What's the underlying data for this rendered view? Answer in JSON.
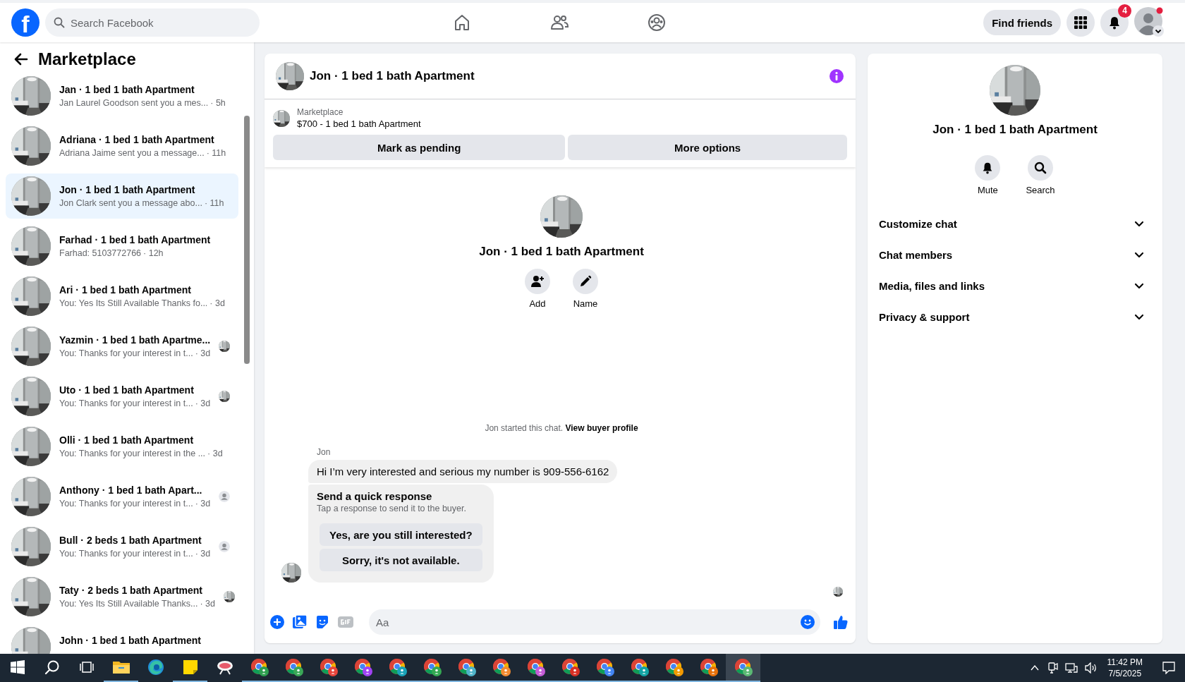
{
  "top_bar": {
    "logo": "f",
    "search": {
      "placeholder": "Search Facebook"
    },
    "nav": [
      {
        "kind": "home",
        "selected": false
      },
      {
        "kind": "friends",
        "selected": false
      },
      {
        "kind": "groups",
        "selected": false
      }
    ],
    "find_friends": "Find friends",
    "notifications_badge": "4"
  },
  "sidebar": {
    "title": "Marketplace",
    "conversations": [
      {
        "title": "Jan · 1 bed 1 bath Apartment",
        "preview": "Jan Laurel Goodson sent you a mes...",
        "time": "· 5h",
        "selected": false
      },
      {
        "title": "Adriana · 1 bed 1 bath Apartment",
        "preview": "Adriana Jaime sent you a message...",
        "time": "· 11h",
        "selected": false
      },
      {
        "title": "Jon · 1 bed 1 bath Apartment",
        "preview": "Jon Clark sent you a message abo...",
        "time": "· 11h",
        "selected": true
      },
      {
        "title": "Farhad · 1 bed 1 bath Apartment",
        "preview": "Farhad: 5103772766",
        "time": "· 12h",
        "selected": false
      },
      {
        "title": "Ari · 1 bed 1 bath Apartment",
        "preview": "You: Yes Its Still Available Thanks fo...",
        "time": "· 3d",
        "selected": false
      },
      {
        "title": "Yazmin · 1 bed 1 bath Apartme...",
        "preview": "You: Thanks for your interest in t...",
        "time": "· 3d",
        "selected": false
      },
      {
        "title": "Uto · 1 bed 1 bath Apartment",
        "preview": "You: Thanks for your interest in t...",
        "time": "· 3d",
        "selected": false
      },
      {
        "title": "Olli · 1 bed 1 bath Apartment",
        "preview": "You: Thanks for your interest in the ...",
        "time": "· 3d",
        "selected": false
      },
      {
        "title": "Anthony · 1 bed 1 bath Apart...",
        "preview": "You: Thanks for your interest in t...",
        "time": "· 3d",
        "selected": false,
        "receipt": {
          "kind": "silhouette"
        }
      },
      {
        "title": "Bull · 2 beds 1 bath Apartment",
        "preview": "You: Thanks for your interest in t...",
        "time": "· 3d",
        "selected": false,
        "receipt": {
          "kind": "silhouette"
        }
      },
      {
        "title": "Taty · 2 beds 1 bath Apartment",
        "preview": "You: Yes Its Still Available Thanks...",
        "time": "· 3d",
        "selected": false
      },
      {
        "title": "John · 1 bed 1 bath Apartment",
        "selected": false
      }
    ]
  },
  "chat": {
    "title": "Jon · 1 bed 1 bath Apartment",
    "listing": {
      "label": "Marketplace",
      "name": "$700 - 1 bed 1 bath Apartment"
    },
    "actions": [
      "Mark as pending",
      "More options"
    ],
    "profile": {
      "title": "Jon · 1 bed 1 bath Apartment",
      "actions": [
        {
          "kind": "add",
          "label": "Add"
        },
        {
          "kind": "name",
          "label": "Name"
        }
      ]
    },
    "notice": {
      "text": "Jon started this chat.",
      "link": "View buyer profile"
    },
    "messages": [
      {
        "sender": "Jon",
        "text": "Hi I’m very interested and serious my number is 909-556-6162"
      }
    ],
    "quick_response": {
      "title": "Send a quick response",
      "hint": "Tap a response to send it to the buyer.",
      "options": [
        "Yes, are you still interested?",
        "Sorry, it's not available."
      ]
    },
    "composer": {
      "placeholder": "Aa"
    }
  },
  "details": {
    "title": "Jon · 1 bed 1 bath Apartment",
    "actions": [
      {
        "kind": "mute",
        "label": "Mute"
      },
      {
        "kind": "search",
        "label": "Search"
      }
    ],
    "sections": [
      {
        "label": "Customize chat",
        "expanded": false
      },
      {
        "label": "Chat members",
        "expanded": false
      },
      {
        "label": "Media, files and links",
        "expanded": false
      },
      {
        "label": "Privacy & support",
        "expanded": false
      }
    ]
  },
  "taskbar": {
    "items": [
      {
        "kind": "start",
        "running": false,
        "selected": false
      },
      {
        "kind": "search",
        "running": false,
        "selected": false
      },
      {
        "kind": "taskview",
        "running": false,
        "selected": false
      },
      {
        "kind": "explorer",
        "running": true,
        "selected": false
      },
      {
        "kind": "edge",
        "running": false,
        "selected": false
      },
      {
        "kind": "notes",
        "running": true,
        "selected": false
      },
      {
        "kind": "app",
        "running": false,
        "selected": false
      },
      {
        "kind": "browser",
        "running": true,
        "selected": false,
        "color": "#2e9e4f"
      },
      {
        "kind": "browser",
        "running": true,
        "selected": false,
        "color": "#3aa757"
      },
      {
        "kind": "browser",
        "running": true,
        "selected": false,
        "color": "#e8453c"
      },
      {
        "kind": "browser",
        "running": true,
        "selected": false,
        "color": "#a142f4"
      },
      {
        "kind": "browser",
        "running": true,
        "selected": false,
        "color": "#1aa3b8"
      },
      {
        "kind": "browser",
        "running": true,
        "selected": false,
        "color": "#34a853"
      },
      {
        "kind": "browser",
        "running": true,
        "selected": false,
        "color": "#4fb3c8"
      },
      {
        "kind": "browser",
        "running": true,
        "selected": false,
        "color": "#f28b30"
      },
      {
        "kind": "browser",
        "running": true,
        "selected": false,
        "color": "#c45cd6"
      },
      {
        "kind": "browser",
        "running": true,
        "selected": false,
        "color": "#d93025"
      },
      {
        "kind": "browser",
        "running": true,
        "selected": false,
        "color": "#4285f4"
      },
      {
        "kind": "browser",
        "running": true,
        "selected": false,
        "color": "#12a4a4"
      },
      {
        "kind": "browser",
        "running": true,
        "selected": false,
        "color": "#f29900"
      },
      {
        "kind": "browser",
        "running": true,
        "selected": false,
        "color": "#e8710a"
      },
      {
        "kind": "browser",
        "running": true,
        "selected": true,
        "color": "#5bb974"
      }
    ],
    "clock": {
      "time": "11:42 PM",
      "date": "7/5/2025"
    }
  }
}
